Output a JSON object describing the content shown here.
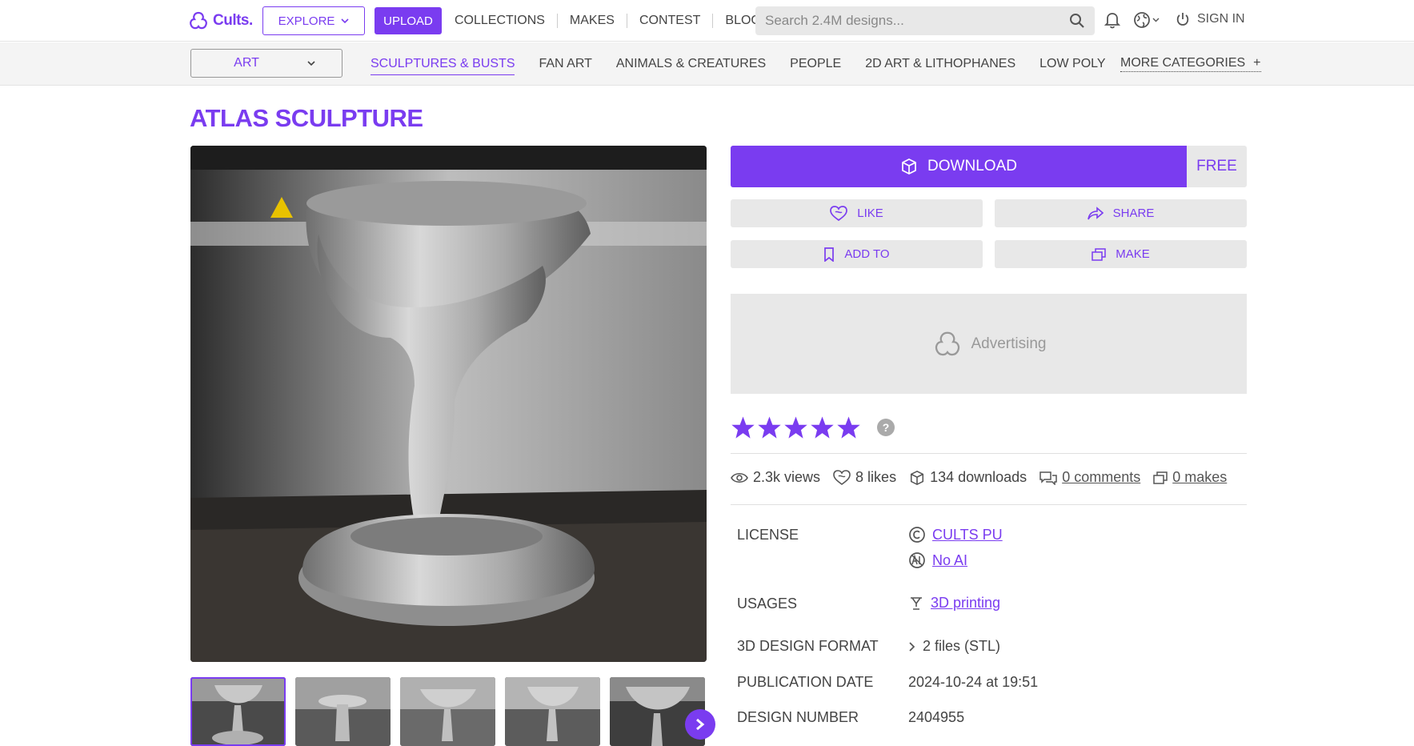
{
  "header": {
    "logo_text": "Cults.",
    "explore_label": "EXPLORE",
    "upload_label": "UPLOAD",
    "nav": [
      "COLLECTIONS",
      "MAKES",
      "CONTEST",
      "BLOG"
    ],
    "search_placeholder": "Search 2.4M designs...",
    "signin_label": "SIGN IN"
  },
  "categories": {
    "selected": "ART",
    "items": [
      "SCULPTURES & BUSTS",
      "FAN ART",
      "ANIMALS & CREATURES",
      "PEOPLE",
      "2D ART & LITHOPHANES",
      "LOW POLY"
    ],
    "active_index": 0,
    "more_label": "MORE CATEGORIES",
    "more_icon": "+"
  },
  "product": {
    "title": "ATLAS SCULPTURE",
    "download_label": "DOWNLOAD",
    "price": "FREE",
    "actions": {
      "like": "LIKE",
      "share": "SHARE",
      "add_to": "ADD TO",
      "make": "MAKE"
    },
    "ad_label": "Advertising",
    "rating": 5,
    "rating_help": "?",
    "stats": {
      "views": "2.3k views",
      "likes": "8 likes",
      "downloads": "134 downloads",
      "comments": "0 comments",
      "makes": "0 makes"
    },
    "details": {
      "license_label": "LICENSE",
      "license_value": "CULTS PU",
      "ai_value": "No AI",
      "usages_label": "USAGES",
      "usages_value": "3D printing",
      "format_label": "3D DESIGN FORMAT",
      "format_value": "2 files (STL)",
      "date_label": "PUBLICATION DATE",
      "date_value": "2024-10-24 at 19:51",
      "number_label": "DESIGN NUMBER",
      "number_value": "2404955"
    },
    "thumbnail_count": 5,
    "selected_thumbnail": 0
  },
  "colors": {
    "accent": "#7a3cf0",
    "button_gray": "#e8e8e8"
  },
  "icons": [
    "cults-logo-icon",
    "chevron-down-icon",
    "search-icon",
    "bell-icon",
    "globe-icon",
    "power-icon",
    "box-icon",
    "heart-icon",
    "share-icon",
    "bookmark-icon",
    "make-icon",
    "star-icon",
    "eye-icon",
    "comment-icon",
    "copyright-icon",
    "no-ai-icon",
    "printer-icon",
    "chevron-right-icon"
  ]
}
